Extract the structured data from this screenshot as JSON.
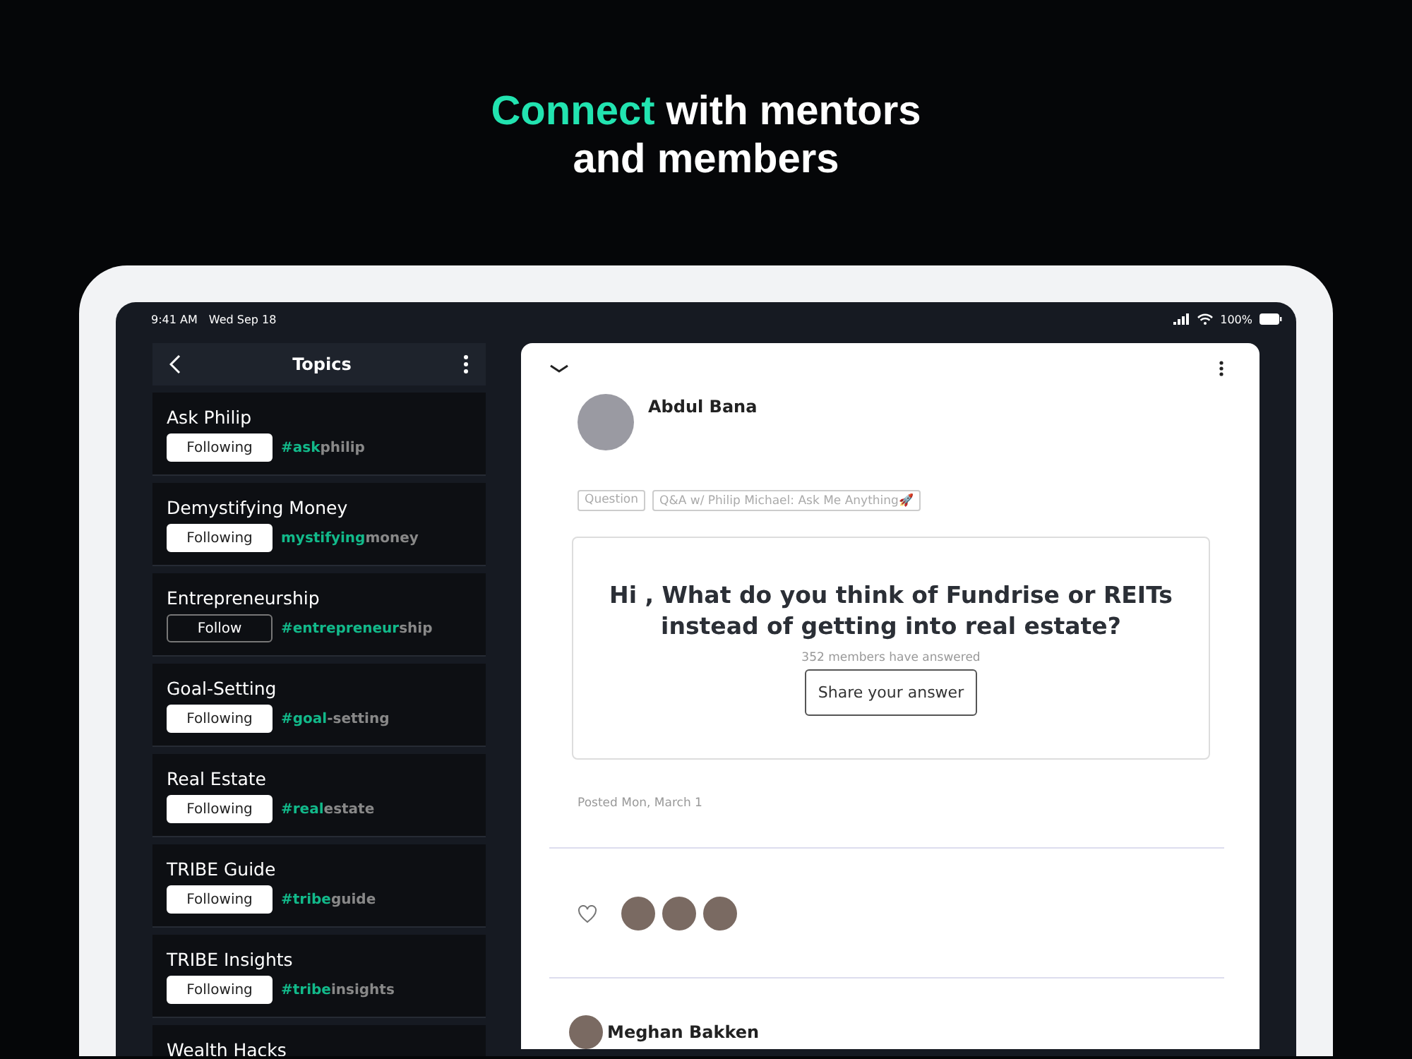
{
  "headline": {
    "accent": "Connect",
    "rest": "with mentors and members"
  },
  "status_bar": {
    "time": "9:41 AM",
    "date": "Wed Sep 18",
    "battery": "100%"
  },
  "topics_panel": {
    "title": "Topics",
    "items": [
      {
        "name": "Ask Philip",
        "button": "Following",
        "following": true,
        "hashtag": {
          "accent": "#ask",
          "rest": "philip"
        }
      },
      {
        "name": "Demystifying Money",
        "button": "Following",
        "following": true,
        "hashtag": {
          "accent": "mystifying",
          "rest": "money"
        }
      },
      {
        "name": "Entrepreneurship",
        "button": "Follow",
        "following": false,
        "hashtag": {
          "accent": "#entrepreneur",
          "rest": "ship"
        }
      },
      {
        "name": "Goal-Setting",
        "button": "Following",
        "following": true,
        "hashtag": {
          "accent": "#goal",
          "rest": "-setting"
        }
      },
      {
        "name": "Real Estate",
        "button": "Following",
        "following": true,
        "hashtag": {
          "accent": "#real",
          "rest": "estate"
        }
      },
      {
        "name": "TRIBE Guide",
        "button": "Following",
        "following": true,
        "hashtag": {
          "accent": "#tribe",
          "rest": "guide"
        }
      },
      {
        "name": "TRIBE Insights",
        "button": "Following",
        "following": true,
        "hashtag": {
          "accent": "#tribe",
          "rest": "insights"
        }
      },
      {
        "name": "Wealth Hacks"
      }
    ]
  },
  "post": {
    "author": "Abdul Bana",
    "tags": [
      "Question",
      "Q&A w/ Philip Michael: Ask Me Anything🚀"
    ],
    "question": "Hi , What do you think of Fundrise or REITs instead of getting into real estate?",
    "answered": "352 members have answered",
    "answer_button": "Share your answer",
    "posted": "Posted Mon, March 1",
    "liked": false,
    "likers": [
      {
        "kind": "photo"
      },
      {
        "kind": "photo"
      },
      {
        "kind": "photo"
      }
    ],
    "reply_author": "Meghan Bakken"
  }
}
